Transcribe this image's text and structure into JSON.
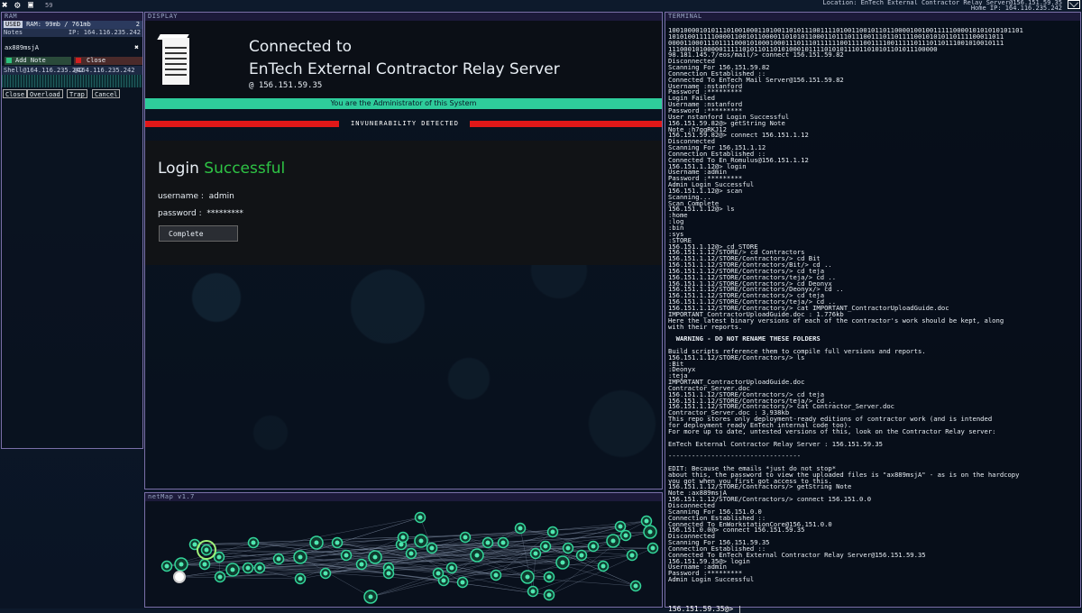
{
  "topbar": {
    "icons": [
      "close-icon",
      "gear-icon",
      "save-icon"
    ],
    "counter": "59",
    "location": "Location: EnTech External Contractor Relay Server@156.151.59.35",
    "home_ip": "Home IP: 164.116.235.242"
  },
  "ram": {
    "title": "RAM",
    "used_label": "USED",
    "usage": "RAM: 99mb / 761mb",
    "count": "2",
    "notes_label": "Notes",
    "notes_ip": "IP: 164.116.235.242",
    "note_text": "ax889msjA",
    "add_note": "Add Note",
    "close": "Close",
    "shell_a": "Shell@164.116.235.242",
    "shell_b": "@164.116.235.242",
    "buttons": [
      "Close",
      "Overload",
      "Trap",
      "Cancel"
    ]
  },
  "display": {
    "title": "DISPLAY",
    "connected_to": "Connected to",
    "server_name": "EnTech External Contractor Relay Server",
    "server_ip": "@  156.151.59.35",
    "admin_msg": "You are the Administrator of this System",
    "invuln_msg": "INVUNERABILITY DETECTED",
    "login_word": "Login",
    "login_status": "Successful",
    "username_label": "username :",
    "username_value": "admin",
    "password_label": "password :",
    "password_value": "*********",
    "complete_button": "Complete"
  },
  "netmap": {
    "title": "netMap v1.7"
  },
  "terminal": {
    "title": "TERMINAL",
    "lines": [
      "1001000010101110100100011010011010111001111010011001011011000010010011111000010101010101101",
      "10101001111100001100101100001101010110001101110111001110110111100101010110111100011011",
      "00001100011101111000101000100011101110111111001111001111001111101110110111001010010111",
      "111000101000001111101011011010100010111101010111011010101101011100000",
      "98.181.145.7/eos/mail/> connect 156.151.59.82",
      "Disconnected",
      "Scanning For 156.151.59.82",
      "Connection Established ::",
      "Connected To EnTech Mail Server@156.151.59.82",
      "Username :nstanford",
      "Password :*********",
      "Login Failed",
      "Username :nstanford",
      "Password :*********",
      "User nstanford Login Successful",
      "156.151.59.82@> getString Note",
      "Note :h7ggRKJ12",
      "156.151.59.82@> connect 156.151.1.12",
      "Disconnected",
      "Scanning For 156.151.1.12",
      "Connection Established ::",
      "Connected To En_Romulus@156.151.1.12",
      "156.151.1.12@> login",
      "Username :admin",
      "Password :*********",
      "Admin Login Successful",
      "156.151.1.12@> scan",
      "Scanning...",
      "Scan Complete",
      "156.151.1.12@> ls",
      ":home",
      ":log",
      ":bin",
      ":sys",
      ":STORE",
      "156.151.1.12@> cd STORE",
      "156.151.1.12/STORE/> cd Contractors",
      "156.151.1.12/STORE/Contractors/> cd Bit",
      "156.151.1.12/STORE/Contractors/Bit/> cd ..",
      "156.151.1.12/STORE/Contractors/> cd teja",
      "156.151.1.12/STORE/Contractors/teja/> cd ..",
      "156.151.1.12/STORE/Contractors/> cd Deonyx",
      "156.151.1.12/STORE/Contractors/Deonyx/> cd ..",
      "156.151.1.12/STORE/Contractors/> cd teja",
      "156.151.1.12/STORE/Contractors/teja/> cd ..",
      "156.151.1.12/STORE/Contractors/> cat IMPORTANT_ContractorUploadGuide.doc",
      "IMPORTANT_ContractorUploadGuide.doc : 1.776kb",
      "Here the latest binary versions of each of the contractor's work should be kept, along",
      "with their reports.",
      "",
      "  WARNING - DO NOT RENAME THESE FOLDERS",
      "",
      "Build scripts reference them to compile full versions and reports.",
      "156.151.1.12/STORE/Contractors/> ls",
      ":Bit",
      ":Deonyx",
      ":teja",
      "IMPORTANT_ContractorUploadGuide.doc",
      "Contractor_Server.doc",
      "156.151.1.12/STORE/Contractors/> cd teja",
      "156.151.1.12/STORE/Contractors/teja/> cd ..",
      "156.151.1.12/STORE/Contractors/> cat Contractor_Server.doc",
      "Contractor_Server.doc : 3.938kb",
      "This repo stores only deployment-ready editions of contractor work (and is intended",
      "for deployment ready EnTech internal code too).",
      "For more up to date, untested versions of this, look on the Contractor Relay server:",
      "",
      "EnTech External Contractor Relay Server : 156.151.59.35",
      "",
      "----------------------------------",
      "",
      "EDIT: Because the emails *just do not stop*",
      "about this, the password to view the uploaded files is \"ax889msjA\" - as is on the hardcopy",
      "you got when you first got access to this.",
      "156.151.1.12/STORE/Contractors/> getString Note",
      "Note :ax889msjA",
      "156.151.1.12/STORE/Contractors/> connect 156.151.0.0",
      "Disconnected",
      "Scanning For 156.151.0.0",
      "Connection Established ::",
      "Connected To EnWorkstationCore@156.151.0.0",
      "156.151.0.0@> connect 156.151.59.35",
      "Disconnected",
      "Scanning For 156.151.59.35",
      "Connection Established ::",
      "Connected To EnTech External Contractor Relay Server@156.151.59.35",
      "156.151.59.35@> login",
      "Username :admin",
      "Password :*********",
      "Admin Login Successful"
    ],
    "prompt": "156.151.59.35@> |"
  },
  "colors": {
    "accent_green": "#2ecc9b",
    "success_green": "#2ec445",
    "alert_red": "#e01818",
    "panel_border": "#7a6fa8"
  }
}
